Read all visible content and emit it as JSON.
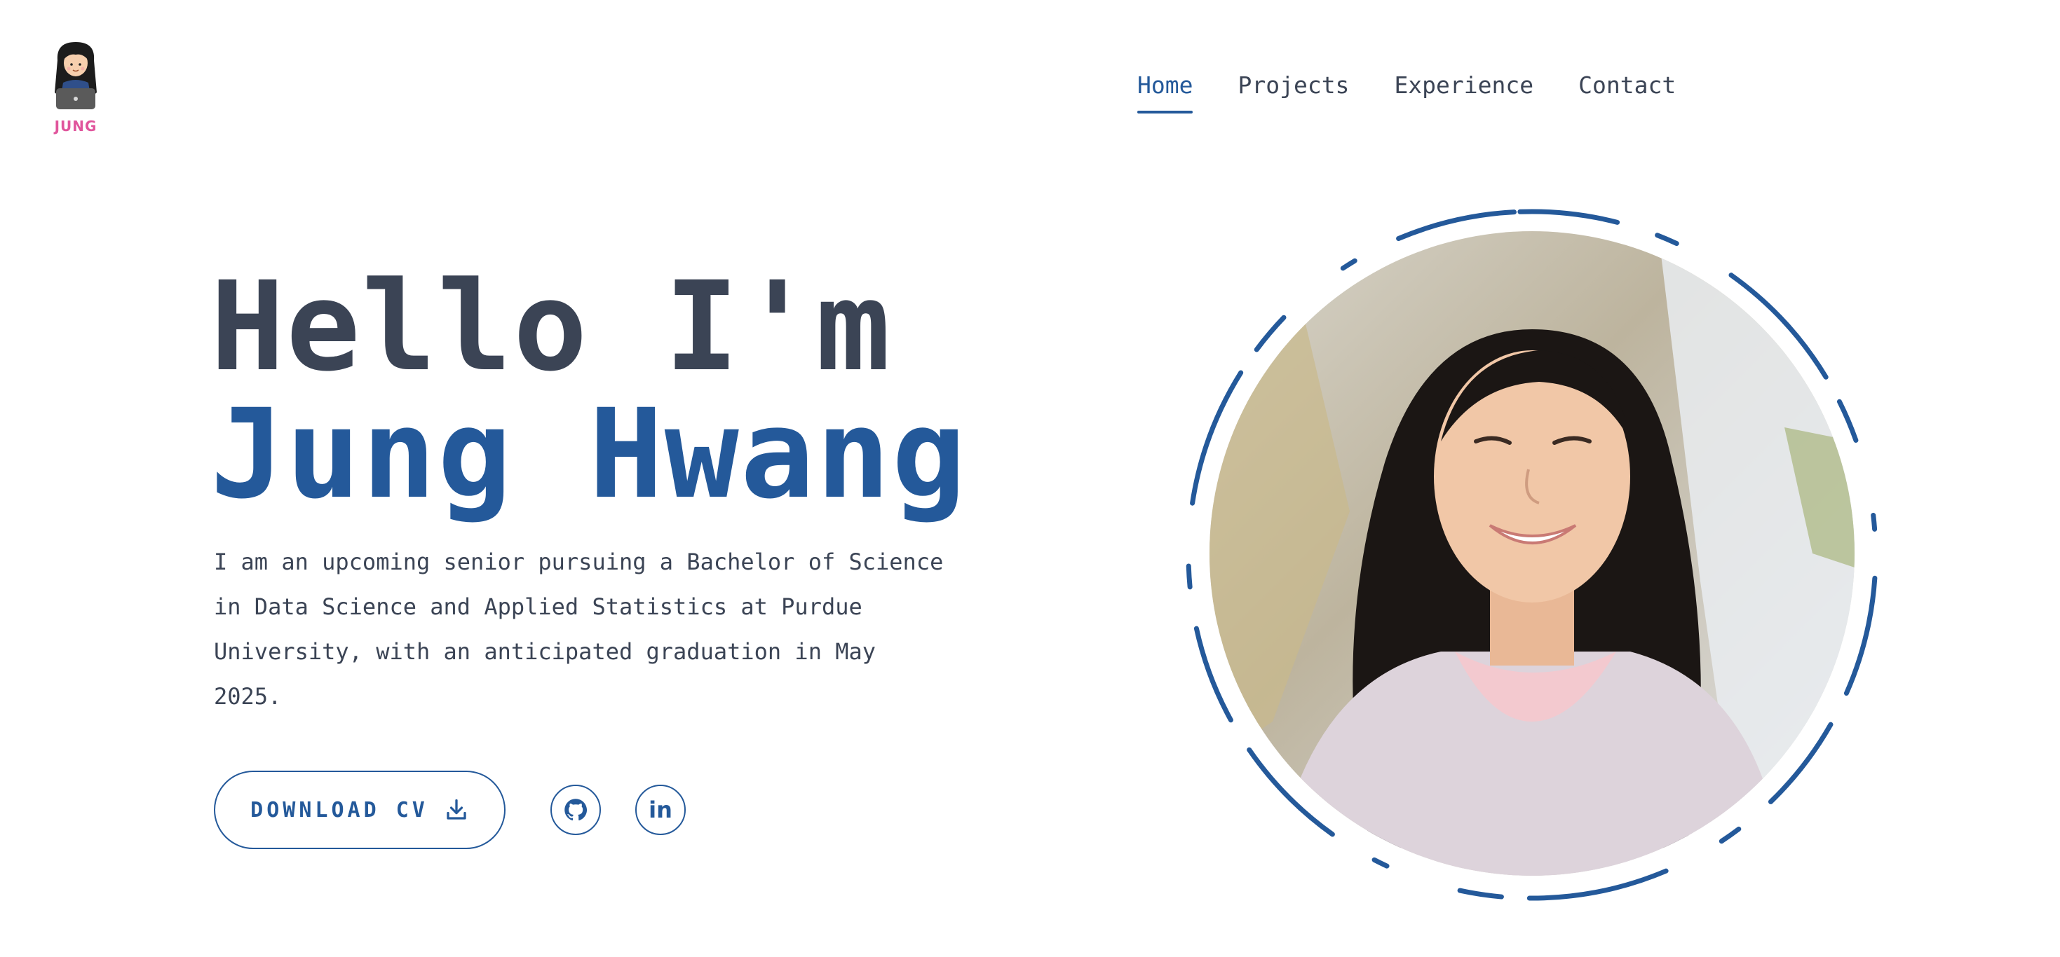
{
  "logo": {
    "word": "JUNG"
  },
  "nav": {
    "items": [
      {
        "label": "Home",
        "active": true
      },
      {
        "label": "Projects",
        "active": false
      },
      {
        "label": "Experience",
        "active": false
      },
      {
        "label": "Contact",
        "active": false
      }
    ]
  },
  "hero": {
    "greeting": "Hello I'm",
    "name": "Jung Hwang",
    "description": "I am an upcoming senior pursuing a Bachelor of Science in Data Science and Applied Statistics at Purdue University, with an anticipated graduation in May 2025.",
    "cv_button": "DOWNLOAD CV",
    "cv_icon": "download-icon",
    "social": [
      {
        "name": "github-icon"
      },
      {
        "name": "linkedin-icon",
        "text": "in"
      }
    ]
  },
  "colors": {
    "accent": "#24599a",
    "text": "#3b4455",
    "logo_pink": "#e0559c",
    "background": "#ffffff"
  }
}
